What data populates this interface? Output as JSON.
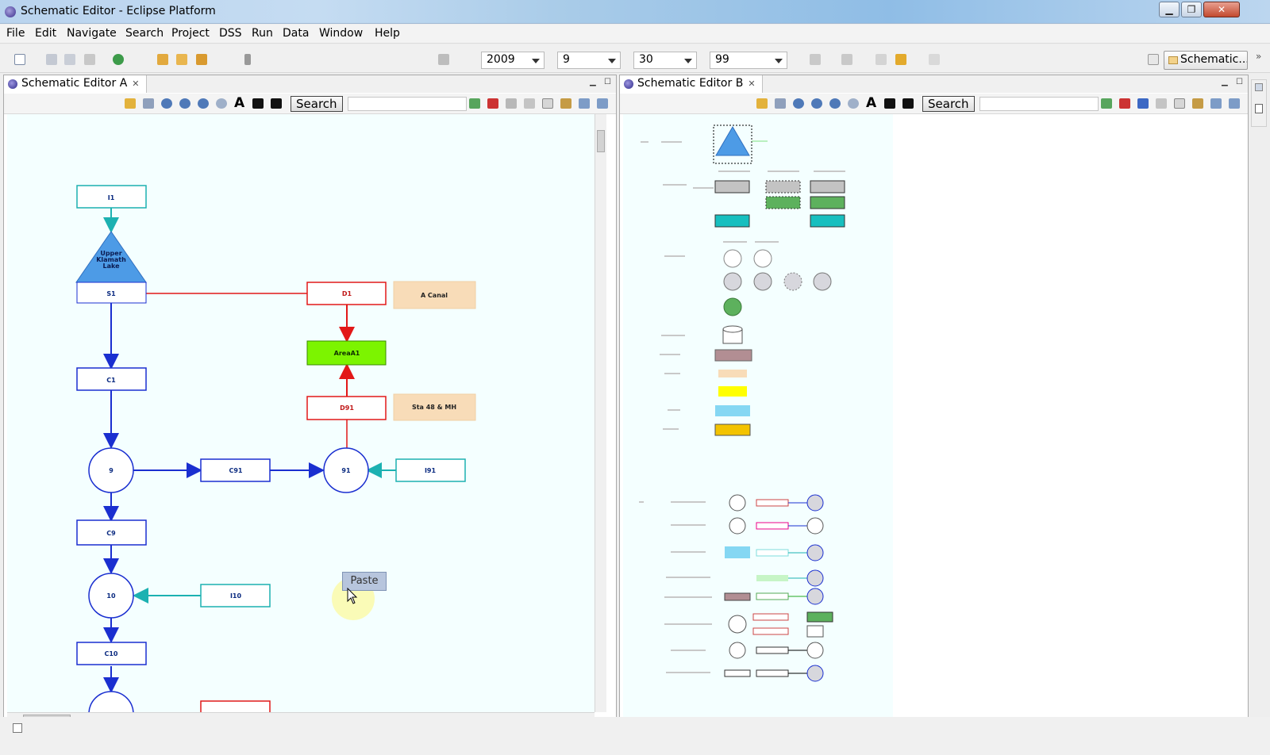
{
  "window": {
    "title": "Schematic Editor - Eclipse Platform"
  },
  "menu": [
    "File",
    "Edit",
    "Navigate",
    "Search",
    "Project",
    "DSS",
    "Run",
    "Data",
    "Window",
    "Help"
  ],
  "toolbar": {
    "year": "2009",
    "month": "9",
    "day": "30",
    "value": "99",
    "perspective": "Schematic..."
  },
  "editor_a": {
    "tab": "Schematic Editor A",
    "search_label": "Search",
    "nodes": {
      "i1": "I1",
      "lake": [
        "Upper",
        "Klamath",
        "Lake"
      ],
      "s1": "S1",
      "c1": "C1",
      "n9": "9",
      "c91": "C91",
      "n91": "91",
      "i91": "I91",
      "c9": "C9",
      "n10": "10",
      "i10": "I10",
      "c10": "C10",
      "d1": "D1",
      "areaA1": "AreaA1",
      "d91": "D91",
      "a_canal": "A Canal",
      "sta48": "Sta 48 & MH"
    },
    "paste_tip": "Paste"
  },
  "editor_b": {
    "tab": "Schematic Editor B",
    "search_label": "Search"
  }
}
